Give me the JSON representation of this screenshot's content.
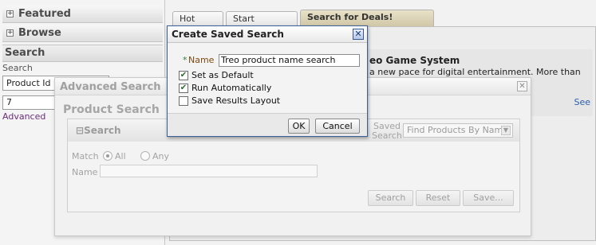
{
  "sidebar": {
    "featured": {
      "label": "Featured",
      "icon": "expand-plus-icon"
    },
    "browse": {
      "label": "Browse",
      "icon": "expand-plus-icon"
    },
    "search_title": "Search",
    "search_label": "Search",
    "search_by_value": "Product Id",
    "search_value": "7",
    "advanced_link": "Advanced"
  },
  "tabs": [
    "Hot Items",
    "Start Shopping!",
    "Search for Deals!"
  ],
  "content": {
    "product_title": "eo Game System",
    "product_description": "a new pace for digital entertainment. More than just a playback, dig",
    "see_link": "See"
  },
  "advanced_search": {
    "title": "Advanced Search",
    "product_search_title": "Product Search",
    "search_box_title": "Search",
    "saved_search_label": "Saved Search",
    "saved_search_value": "Find Products By Name",
    "match_label": "Match",
    "match_options": [
      "All",
      "Any"
    ],
    "match_selected": "All",
    "name_label": "Name",
    "name_value": "",
    "buttons": {
      "search": "Search",
      "reset": "Reset",
      "save": "Save..."
    }
  },
  "dialog": {
    "title": "Create Saved Search",
    "required_marker": "*",
    "name_label": "Name",
    "name_value": "Treo product name search",
    "checkboxes": [
      {
        "label": "Set as Default",
        "checked": true
      },
      {
        "label": "Run Automatically",
        "checked": true
      },
      {
        "label": "Save Results Layout",
        "checked": false
      }
    ],
    "ok_label": "OK",
    "cancel_label": "Cancel"
  },
  "colors": {
    "dialog_border": "#3b5f98",
    "active_tab": "#cfc6a5",
    "advanced_link": "#6b2c7e",
    "required_marker": "#3a7a3a",
    "name_label": "#7a4a12"
  }
}
